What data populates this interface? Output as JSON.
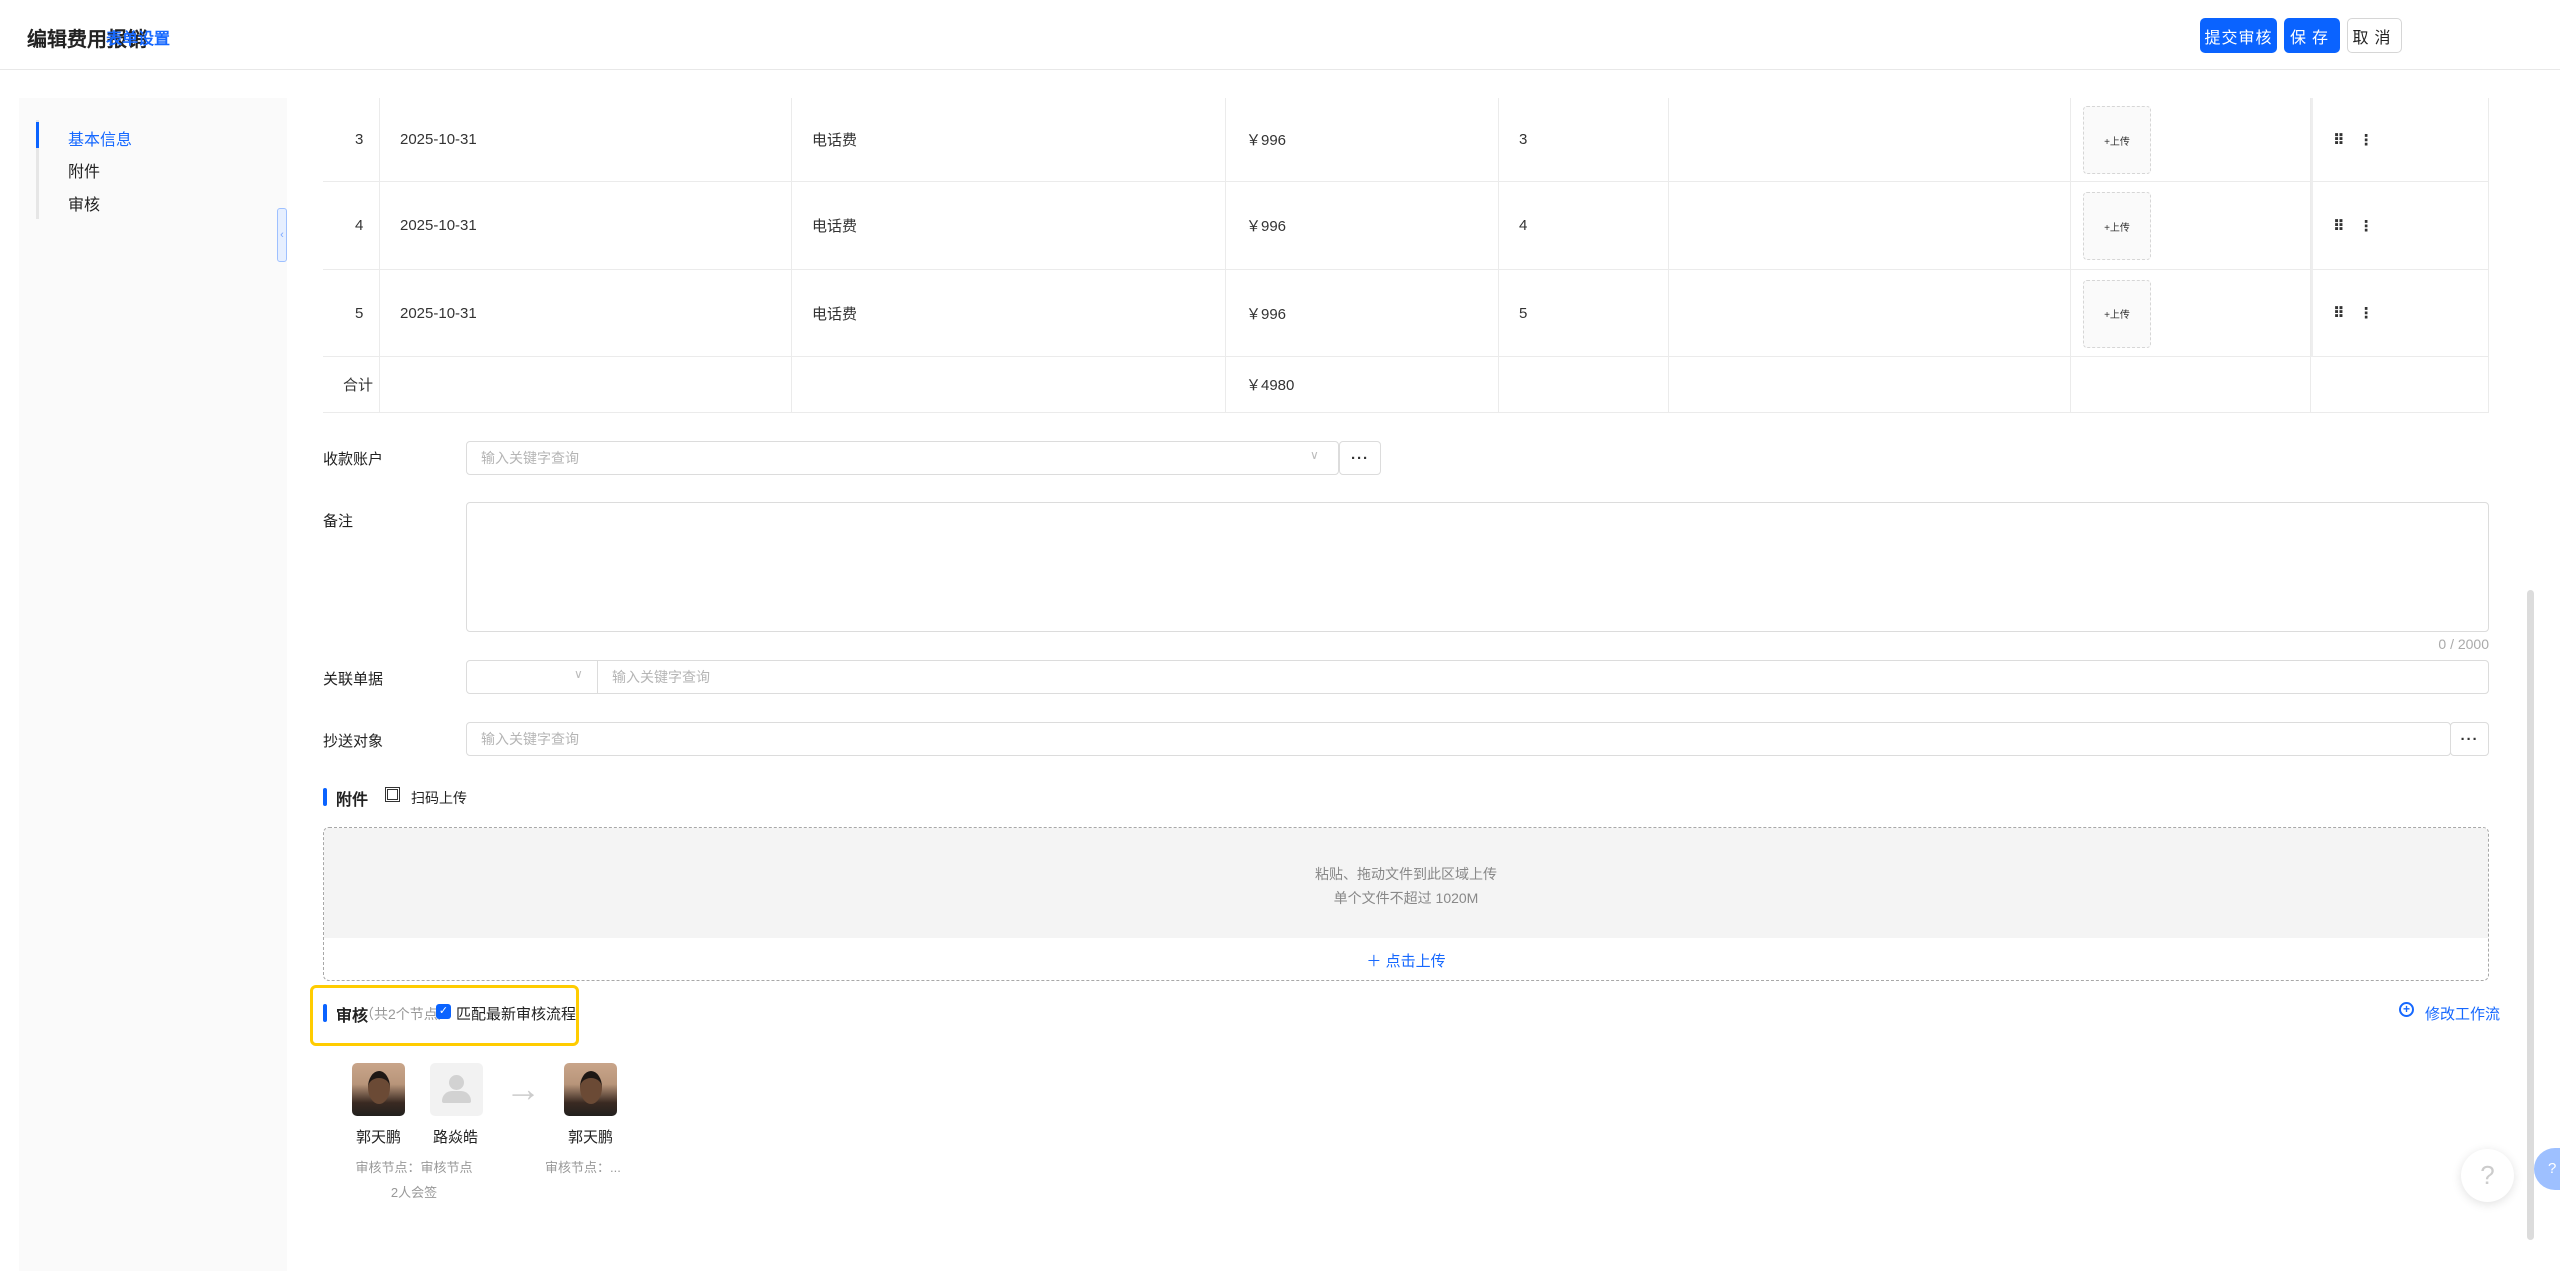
{
  "header": {
    "title": "编辑费用报销",
    "form_settings": "表单设置",
    "submit": "提交审核",
    "save": "保存",
    "cancel": "取消"
  },
  "sidebar": {
    "items": [
      {
        "label": "基本信息"
      },
      {
        "label": "附件"
      },
      {
        "label": "审核"
      }
    ]
  },
  "table": {
    "rows": [
      {
        "index": "3",
        "date": "2025-10-31",
        "type": "电话费",
        "amount": "￥996",
        "qty": "3",
        "upload": "+上传"
      },
      {
        "index": "4",
        "date": "2025-10-31",
        "type": "电话费",
        "amount": "￥996",
        "qty": "4",
        "upload": "+上传"
      },
      {
        "index": "5",
        "date": "2025-10-31",
        "type": "电话费",
        "amount": "￥996",
        "qty": "5",
        "upload": "+上传"
      }
    ],
    "total_label": "合计",
    "total_amount": "￥4980"
  },
  "form": {
    "account_label": "收款账户",
    "account_placeholder": "输入关键字查询",
    "remark_label": "备注",
    "remark_count": "0 / 2000",
    "related_label": "关联单据",
    "related_placeholder": "输入关键字查询",
    "cc_label": "抄送对象",
    "cc_placeholder": "输入关键字查询",
    "more": "···"
  },
  "attachment": {
    "title": "附件",
    "scan": "扫码上传",
    "drop_text": "粘贴、拖动文件到此区域上传",
    "limit": "单个文件不超过 1020M",
    "click_upload": "点击上传"
  },
  "approval": {
    "title": "审核",
    "node_count": "（共2个节点）",
    "match_label": "匹配最新审核流程",
    "match_checked": true,
    "modify": "修改工作流",
    "nodes": [
      {
        "name": "郭天鹏"
      },
      {
        "name": "路焱皓"
      },
      {
        "name": "郭天鹏"
      }
    ],
    "node1_sub": "审核节点：审核节点",
    "node1_sign": "2人会签",
    "node2_sub": "审核节点：..."
  },
  "colors": {
    "accent": "#0a63ff",
    "highlight": "#ffcc00"
  }
}
